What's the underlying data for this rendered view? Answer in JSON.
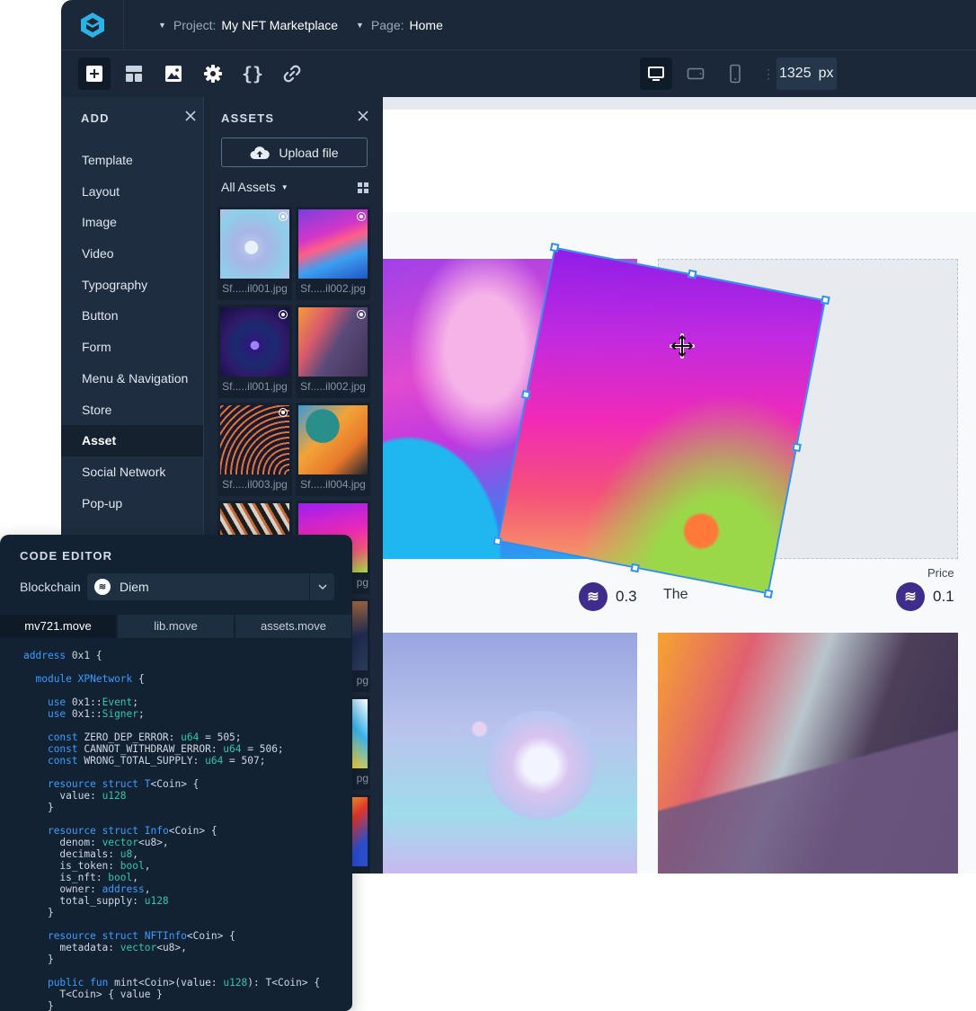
{
  "topbar": {
    "project_label": "Project:",
    "project_value": "My NFT Marketplace",
    "page_label": "Page:",
    "page_value": "Home"
  },
  "toolbar": {
    "tools": [
      "add-icon",
      "layout-icon",
      "image-icon",
      "settings-icon",
      "code-icon",
      "link-icon"
    ],
    "devices": [
      "desktop-icon",
      "tablet-icon",
      "mobile-icon"
    ],
    "separator": "⋮",
    "width_value": "1325",
    "width_unit": "px"
  },
  "add_panel": {
    "title": "ADD",
    "items": [
      "Template",
      "Layout",
      "Image",
      "Video",
      "Typography",
      "Button",
      "Form",
      "Menu & Navigation",
      "Store",
      "Asset",
      "Social Network",
      "Pop-up"
    ],
    "active": "Asset"
  },
  "assets_panel": {
    "title": "ASSETS",
    "upload_label": "Upload file",
    "filter_label": "All Assets",
    "thumbs": [
      "Sf.....il001.jpg",
      "Sf.....il002.jpg",
      "Sf.....il001.jpg",
      "Sf.....il002.jpg",
      "Sf.....il003.jpg",
      "Sf.....il004.jpg"
    ],
    "partial_name": "pg"
  },
  "canvas": {
    "price_label": "Price",
    "price_left": "0.3",
    "price_right": "0.1",
    "price_partial": "The"
  },
  "code_editor": {
    "title": "CODE EDITOR",
    "blockchain_label": "Blockchain",
    "blockchain_value": "Diem",
    "tabs": [
      "mv721.move",
      "lib.move",
      "assets.move"
    ],
    "active_tab": "mv721.move",
    "code_lines": [
      "address 0x1 {",
      "",
      "  module XPNetwork {",
      "",
      "    use 0x1::Event;",
      "    use 0x1::Signer;",
      "",
      "    const ZERO_DEP_ERROR: u64 = 505;",
      "    const CANNOT_WITHDRAW_ERROR: u64 = 506;",
      "    const WRONG_TOTAL_SUPPLY: u64 = 507;",
      "",
      "    resource struct T<Coin> {",
      "      value: u128",
      "    }",
      "",
      "    resource struct Info<Coin> {",
      "      denom: vector<u8>,",
      "      decimals: u8,",
      "      is_token: bool,",
      "      is_nft: bool,",
      "      owner: address,",
      "      total_supply: u128",
      "    }",
      "",
      "    resource struct NFTInfo<Coin> {",
      "      metadata: vector<u8>,",
      "    }",
      "",
      "    public fun mint<Coin>(value: u128): T<Coin> {",
      "      T<Coin> { value }",
      "    }"
    ]
  },
  "colors": {
    "dark_bg": "#1a2839",
    "panel_bg": "#1e2d3f",
    "accent_blue": "#2f8ff0",
    "code_keyword": "#3b9cff",
    "code_type": "#2fc8a8",
    "coin": "#3f2d8b"
  }
}
